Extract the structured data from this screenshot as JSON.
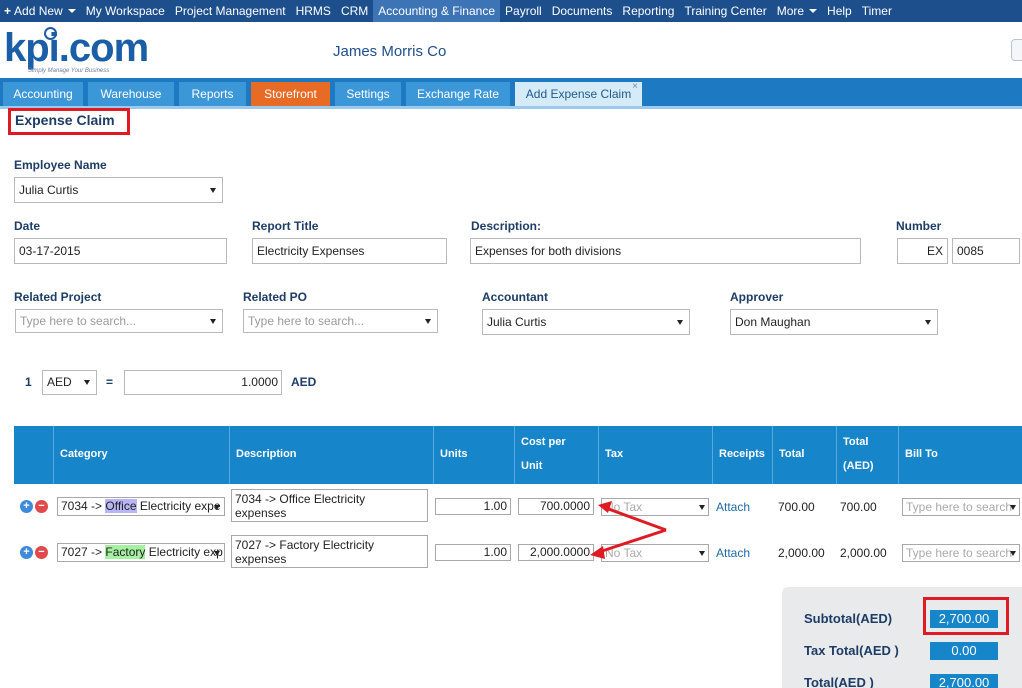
{
  "topnav": {
    "items": [
      {
        "label": "Add New",
        "icon": "plus-icon",
        "dropdown": true
      },
      {
        "label": "My Workspace"
      },
      {
        "label": "Project Management"
      },
      {
        "label": "HRMS"
      },
      {
        "label": "CRM"
      },
      {
        "label": "Accounting & Finance",
        "active": true
      },
      {
        "label": "Payroll"
      },
      {
        "label": "Documents"
      },
      {
        "label": "Reporting"
      },
      {
        "label": "Training Center"
      },
      {
        "label": "More",
        "dropdown": true
      },
      {
        "label": "Help"
      },
      {
        "label": "Timer"
      }
    ]
  },
  "header": {
    "logo_text": "kpi.com",
    "logo_tagline": "Simply Manage Your Business",
    "company": "James Morris Co"
  },
  "tabs": [
    {
      "label": "Accounting"
    },
    {
      "label": "Warehouse"
    },
    {
      "label": "Reports"
    },
    {
      "label": "Storefront",
      "color": "#e86b25"
    },
    {
      "label": "Settings"
    },
    {
      "label": "Exchange Rate"
    },
    {
      "label": "Add Expense Claim",
      "active": true,
      "close": "×"
    }
  ],
  "form": {
    "title": "Expense Claim",
    "employee_label": "Employee Name",
    "employee_value": "Julia Curtis",
    "date_label": "Date",
    "date_value": "03-17-2015",
    "report_title_label": "Report Title",
    "report_title_value": "Electricity Expenses",
    "description_label": "Description:",
    "description_value": "Expenses for both divisions",
    "number_label": "Number",
    "number_prefix": "EX",
    "number_value": "0085",
    "related_project_label": "Related Project",
    "related_project_placeholder": "Type here to search...",
    "related_po_label": "Related PO",
    "related_po_placeholder": "Type here to search...",
    "accountant_label": "Accountant",
    "accountant_value": "Julia Curtis",
    "approver_label": "Approver",
    "approver_value": "Don Maughan"
  },
  "currency": {
    "amount": "1",
    "code": "AED",
    "equals": "=",
    "rate": "1.0000",
    "base": "AED"
  },
  "table": {
    "headers": {
      "category": "Category",
      "description": "Description",
      "units": "Units",
      "cost1": "Cost per",
      "cost2": "Unit",
      "tax": "Tax",
      "receipts": "Receipts",
      "total": "Total",
      "total_aed1": "Total",
      "total_aed2": "(AED)",
      "bill_to": "Bill To"
    },
    "rows": [
      {
        "cat_code": "7034 -> ",
        "cat_hl": "Office",
        "cat_rest": " Electricity expe",
        "desc1": "7034 -> Office Electricity",
        "desc2": "expenses",
        "units": "1.00",
        "cost": "700.0000",
        "tax": "No Tax",
        "receipt": "Attach",
        "total": "700.00",
        "total_aed": "700.00",
        "bill_to": "Type here to search"
      },
      {
        "cat_code": "7027 -> ",
        "cat_hl": "Factory",
        "cat_rest": " Electricity exp",
        "desc1": "7027 -> Factory Electricity",
        "desc2": "expenses",
        "units": "1.00",
        "cost": "2,000.0000",
        "tax": "No Tax",
        "receipt": "Attach",
        "total": "2,000.00",
        "total_aed": "2,000.00",
        "bill_to": "Type here to search"
      }
    ]
  },
  "totals": {
    "subtotal_label": "Subtotal(AED)",
    "subtotal_value": "2,700.00",
    "tax_label": "Tax Total(AED )",
    "tax_value": "0.00",
    "total_label": "Total(AED )",
    "total_value": "2,700.00"
  },
  "colors": {
    "nav": "#1d4f8d",
    "tabbar": "#1d7ac2",
    "accent": "#1785c9",
    "annotation_red": "#e01a22"
  }
}
